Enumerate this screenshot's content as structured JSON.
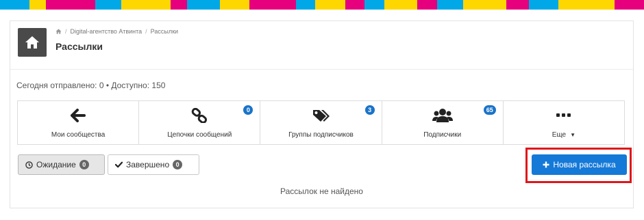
{
  "topbar": {
    "colors": [
      "#00a8e8",
      "#ffd700",
      "#e6007e",
      "#00a8e8",
      "#ffd700",
      "#e6007e",
      "#00a8e8",
      "#ffd700",
      "#e6007e",
      "#00a8e8",
      "#ffd700",
      "#e6007e",
      "#00a8e8",
      "#ffd700",
      "#e6007e",
      "#00a8e8",
      "#ffd700",
      "#e6007e",
      "#00a8e8",
      "#ffd700",
      "#e6007e"
    ]
  },
  "header": {
    "breadcrumb": {
      "home_icon": "home-icon",
      "separator": "/",
      "items": [
        "Digital-агентство Атвинта",
        "Рассылки"
      ]
    },
    "title": "Рассылки"
  },
  "stats": "Сегодня отправлено: 0 • Доступно: 150",
  "nav": [
    {
      "label": "Мои сообщества",
      "icon": "arrow-left-icon",
      "badge": ""
    },
    {
      "label": "Цепочки сообщений",
      "icon": "link-icon",
      "badge": "0"
    },
    {
      "label": "Группы подписчиков",
      "icon": "tags-icon",
      "badge": "3"
    },
    {
      "label": "Подписчики",
      "icon": "users-icon",
      "badge": "65"
    },
    {
      "label": "Еще",
      "icon": "ellipsis-icon",
      "badge": "",
      "caret": "▼"
    }
  ],
  "filters": {
    "waiting": {
      "label": "Ожидание",
      "count": "0",
      "icon": "clock-icon"
    },
    "done": {
      "label": "Завершено",
      "count": "0",
      "icon": "check-icon"
    }
  },
  "new_button": {
    "label": "Новая рассылка",
    "icon": "plus-icon"
  },
  "empty_message": "Рассылок не найдено",
  "colors": {
    "primary": "#1579d8",
    "badge": "#1a73c9",
    "highlight": "#e0161a",
    "dark_tile": "#4a4a4a"
  }
}
